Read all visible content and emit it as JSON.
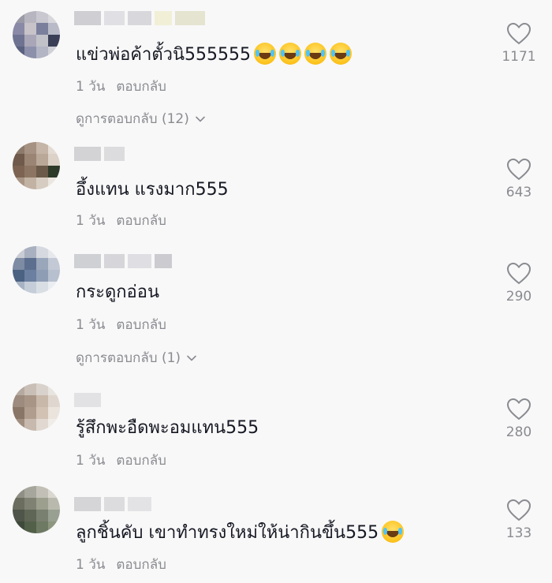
{
  "comments": [
    {
      "text": "แข่วพ่อค้าตั้วนิ555555",
      "emoji_count": 4,
      "time": "1 วัน",
      "reply_label": "ตอบกลับ",
      "view_replies": "ดูการตอบกลับ (12)",
      "likes": "1171",
      "avatar_colors": [
        "#9a9aa6",
        "#b7b5bf",
        "#c9c7cf",
        "#d8d7dc",
        "#8a89a6",
        "#c7c3c8",
        "#7a7f9c",
        "#b9bac8",
        "#6e7391",
        "#a9a6b8",
        "#c1c1c9",
        "#3a3f57",
        "#5b627f",
        "#8d90aa",
        "#b3b4c4",
        "#d0d0d8"
      ],
      "username_blocks": [
        "#cfcfd3",
        "#e0e0e4",
        "#d8d8dc",
        "#f1efd6",
        "#e5e4d0"
      ]
    },
    {
      "text": "อึ้งแทน แรงมาก555",
      "emoji_count": 0,
      "time": "1 วัน",
      "reply_label": "ตอบกลับ",
      "view_replies": "",
      "likes": "643",
      "avatar_colors": [
        "#8c7a6c",
        "#a69282",
        "#c4b5a8",
        "#e4dcd4",
        "#6f5a4b",
        "#9a8474",
        "#b9a797",
        "#dcd2c8",
        "#7c6352",
        "#8d7563",
        "#6b5a49",
        "#2e3a29",
        "#a99585",
        "#c2b2a4",
        "#d7ccc1",
        "#ece6e0"
      ],
      "username_blocks": [
        "#d3d3d6",
        "#dcdcde"
      ]
    },
    {
      "text": "กระดูกอ่อน",
      "emoji_count": 0,
      "time": "1 วัน",
      "reply_label": "ตอบกลับ",
      "view_replies": "ดูการตอบกลับ (1)",
      "likes": "290",
      "avatar_colors": [
        "#c9ccd4",
        "#a9b0bf",
        "#d6d9df",
        "#e6e8ec",
        "#7d8ba3",
        "#5d6f8f",
        "#9aa6b9",
        "#c3cad5",
        "#4c6283",
        "#6b7fa0",
        "#8e9db4",
        "#b6c0cf",
        "#a7b3c4",
        "#c5cdd8",
        "#d9dee5",
        "#eaedf1"
      ],
      "username_blocks": [
        "#cfd0d4",
        "#d6d6da",
        "#dfdfe3",
        "#cbcbd0"
      ]
    },
    {
      "text": "รู้สึกพะอืดพะอมแทน555",
      "emoji_count": 0,
      "time": "1 วัน",
      "reply_label": "ตอบกลับ",
      "view_replies": "",
      "likes": "280",
      "avatar_colors": [
        "#b6aaa0",
        "#c9bfb6",
        "#d9d2cc",
        "#e8e4e0",
        "#9c8b7e",
        "#a99586",
        "#c8b8a9",
        "#dfd7cf",
        "#8a7667",
        "#b19d8d",
        "#d2c2b4",
        "#ebe4dd",
        "#a08e80",
        "#c7b9ad",
        "#e0d8d1",
        "#f0ece8"
      ],
      "username_blocks": [
        "#e2e2e5"
      ]
    },
    {
      "text": "ลูกชิ้นคับ เขาทำทรงใหม่ให้น่ากินขึ้น555",
      "emoji_count": 1,
      "time": "1 วัน",
      "reply_label": "ตอบกลับ",
      "view_replies": "",
      "likes": "133",
      "avatar_colors": [
        "#8f8f86",
        "#a7a69c",
        "#c2c0b6",
        "#d9d7cf",
        "#6b6e5f",
        "#7f8272",
        "#9c9e8e",
        "#b9baad",
        "#4f5548",
        "#5f6656",
        "#7a8070",
        "#98a092",
        "#3f4a3c",
        "#536049",
        "#6e7a63",
        "#8d977f"
      ],
      "username_blocks": [
        "#d5d5d8",
        "#dcdcdf",
        "#e3e3e6"
      ]
    }
  ],
  "colors": {
    "background": "#f8f8f8",
    "text": "#161823",
    "muted": "#8a8b91"
  },
  "icons": {
    "like": "heart-outline-icon",
    "expand": "chevron-down-icon",
    "emoji": "face-with-tears-of-joy-emoji"
  }
}
